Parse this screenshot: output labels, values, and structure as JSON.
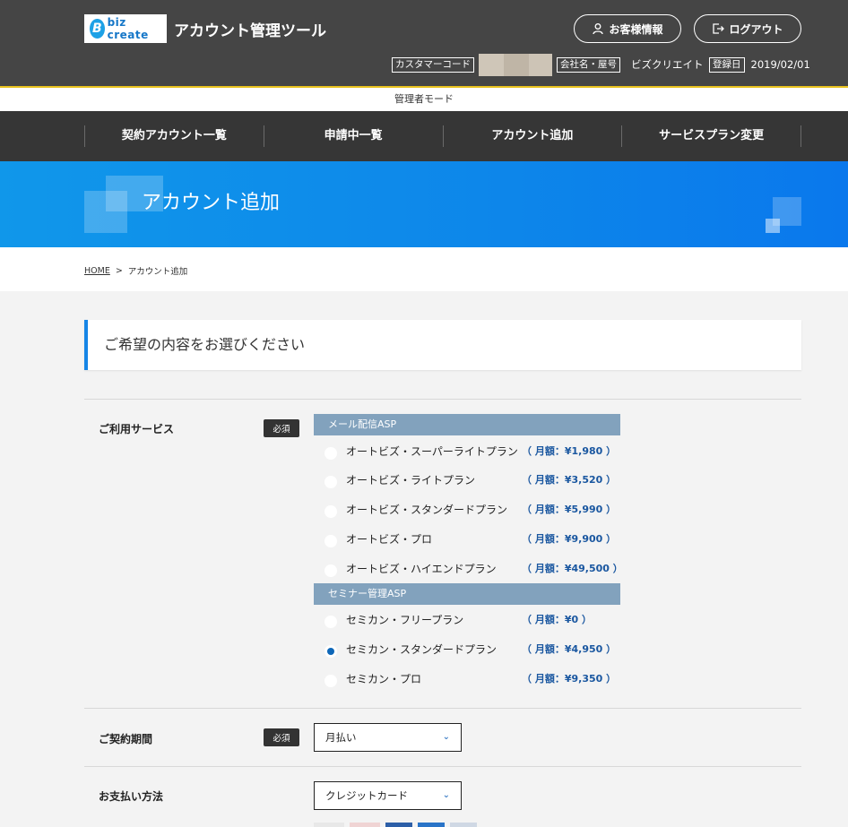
{
  "header": {
    "logo_text": "biz create",
    "logo_mark": "B",
    "app_title": "アカウント管理ツール",
    "customer_info_label": "お客様情報",
    "logout_label": "ログアウト",
    "customer_code_label": "カスタマーコード",
    "company_label": "会社名・屋号",
    "company_value": "ビズクリエイト",
    "registered_label": "登録日",
    "registered_value": "2019/02/01"
  },
  "mode_bar": {
    "text": "管理者モード"
  },
  "nav": [
    {
      "label": "契約アカウント一覧"
    },
    {
      "label": "申請中一覧"
    },
    {
      "label": "アカウント追加"
    },
    {
      "label": "サービスプラン変更"
    }
  ],
  "hero": {
    "title": "アカウント追加"
  },
  "breadcrumb": {
    "home": "HOME",
    "separator": ">",
    "current": "アカウント追加"
  },
  "section": {
    "heading": "ご希望の内容をお選びください"
  },
  "form": {
    "required_label": "必須",
    "service_label": "ご利用サービス",
    "groups": [
      {
        "title": "メール配信ASP",
        "plans": [
          {
            "name": "オートビズ・スーパーライトプラン",
            "price": "（ 月額：¥1,980 ）",
            "selected": false
          },
          {
            "name": "オートビズ・ライトプラン",
            "price": "（ 月額：¥3,520 ）",
            "selected": false
          },
          {
            "name": "オートビズ・スタンダードプラン",
            "price": "（ 月額：¥5,990 ）",
            "selected": false
          },
          {
            "name": "オートビズ・プロ",
            "price": "（ 月額：¥9,900 ）",
            "selected": false
          },
          {
            "name": "オートビズ・ハイエンドプラン",
            "price": "（ 月額：¥49,500 ）",
            "selected": false
          }
        ]
      },
      {
        "title": "セミナー管理ASP",
        "plans": [
          {
            "name": "セミカン・フリープラン",
            "price": "（ 月額：¥0 ）",
            "selected": false
          },
          {
            "name": "セミカン・スタンダードプラン",
            "price": "（ 月額：¥4,950 ）",
            "selected": true
          },
          {
            "name": "セミカン・プロ",
            "price": "（ 月額：¥9,350 ）",
            "selected": false
          }
        ]
      }
    ],
    "period_label": "ご契約期間",
    "period_value": "月払い",
    "payment_label": "お支払い方法",
    "payment_value": "クレジットカード"
  },
  "colors": {
    "header_bg": "#454545",
    "nav_bg": "#363636",
    "accent": "#1685e6",
    "group_bar": "#82a2bd",
    "price": "#1a57a0"
  }
}
